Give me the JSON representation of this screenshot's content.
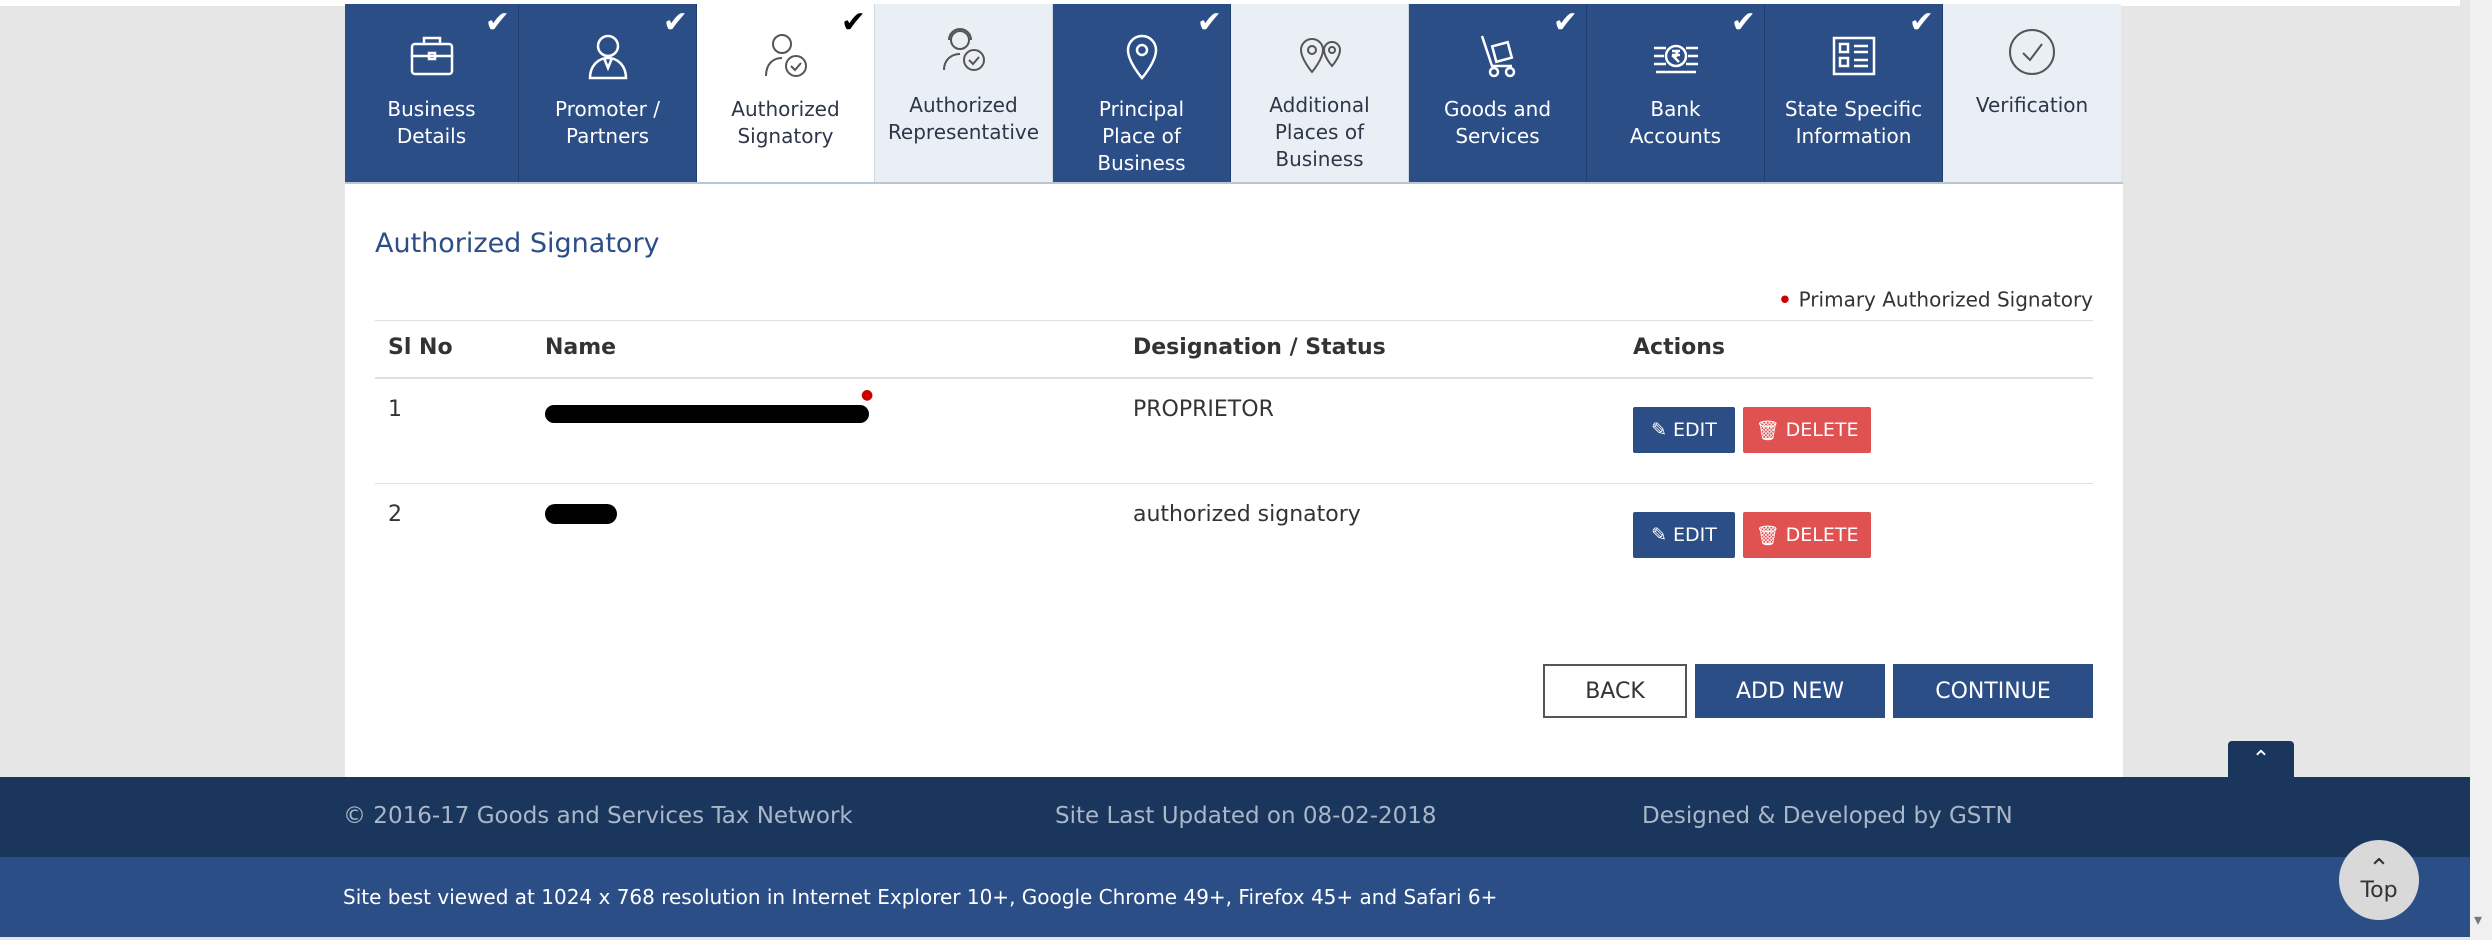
{
  "tabs": [
    {
      "label_line1": "Business",
      "label_line2": "Details",
      "label_line3": "",
      "icon": "briefcase-icon",
      "completed": true
    },
    {
      "label_line1": "Promoter /",
      "label_line2": "Partners",
      "label_line3": "",
      "icon": "person-icon",
      "completed": true
    },
    {
      "label_line1": "Authorized",
      "label_line2": "Signatory",
      "label_line3": "",
      "icon": "person-check-icon",
      "completed": true,
      "active": true
    },
    {
      "label_line1": "Authorized",
      "label_line2": "Representative",
      "label_line3": "",
      "icon": "headset-person-icon",
      "completed": false
    },
    {
      "label_line1": "Principal",
      "label_line2": "Place of",
      "label_line3": "Business",
      "icon": "location-pin-icon",
      "completed": true
    },
    {
      "label_line1": "Additional",
      "label_line2": "Places of",
      "label_line3": "Business",
      "icon": "multi-location-icon",
      "completed": false
    },
    {
      "label_line1": "Goods and",
      "label_line2": "Services",
      "label_line3": "",
      "icon": "hand-truck-icon",
      "completed": true
    },
    {
      "label_line1": "Bank",
      "label_line2": "Accounts",
      "label_line3": "",
      "icon": "rupee-bank-icon",
      "completed": true
    },
    {
      "label_line1": "State Specific",
      "label_line2": "Information",
      "label_line3": "",
      "icon": "info-card-icon",
      "completed": true
    },
    {
      "label_line1": "Verification",
      "label_line2": "",
      "label_line3": "",
      "icon": "check-circle-icon",
      "completed": false
    }
  ],
  "section_title": "Authorized Signatory",
  "legend": "Primary Authorized Signatory",
  "table": {
    "headers": [
      "Sl No",
      "Name",
      "Designation / Status",
      "Actions"
    ],
    "rows": [
      {
        "sl": "1",
        "designation": "PROPRIETOR"
      },
      {
        "sl": "2",
        "designation": "authorized signatory"
      }
    ],
    "edit_label": "EDIT",
    "delete_label": "DELETE"
  },
  "buttons": {
    "back": "BACK",
    "add_new": "ADD NEW",
    "continue": "CONTINUE"
  },
  "footer": {
    "copyright": "© 2016-17 Goods and Services Tax Network",
    "updated": "Site Last Updated on 08-02-2018",
    "designed": "Designed & Developed by GSTN",
    "best_viewed": "Site best viewed at 1024 x 768 resolution in Internet Explorer 10+, Google Chrome 49+, Firefox 45+ and Safari 6+"
  },
  "top_button": "Top",
  "colors": {
    "primary": "#2c4e87",
    "footer_dark": "#1b365d",
    "danger": "#e05251"
  }
}
